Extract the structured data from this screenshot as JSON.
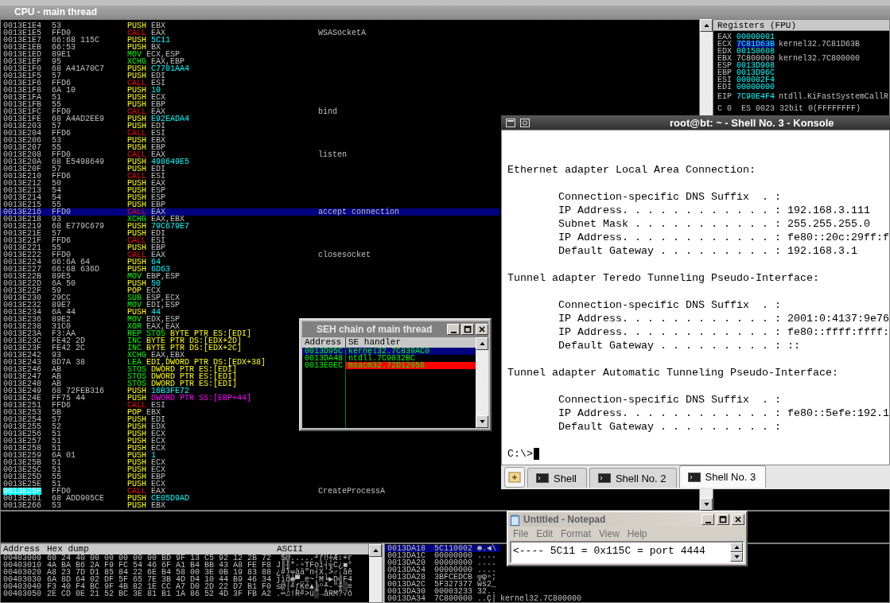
{
  "cpu_window": {
    "title": "CPU - main thread"
  },
  "disassembly": {
    "rows": [
      {
        "address": "0013E1E4",
        "hex": "53",
        "mnemonic": "PUSH",
        "kind": "stack",
        "operand": {
          "text": "EBX",
          "kind": "register"
        },
        "selected": false,
        "marked": false
      },
      {
        "address": "0013E1E5",
        "hex": "FFD0",
        "mnemonic": "CALL",
        "kind": "call",
        "operand": {
          "text": "EAX",
          "kind": "register"
        },
        "comment": "WSASocketA",
        "selected": false,
        "marked": false
      },
      {
        "address": "0013E1E7",
        "hex": "66:68 115C",
        "mnemonic": "PUSH",
        "kind": "stack",
        "operand": {
          "text": "5C11",
          "kind": "constant"
        },
        "selected": false,
        "marked": false
      },
      {
        "address": "0013E1EB",
        "hex": "66:53",
        "mnemonic": "PUSH",
        "kind": "stack",
        "operand": {
          "text": "BX",
          "kind": "register"
        },
        "selected": false,
        "marked": false
      },
      {
        "address": "0013E1ED",
        "hex": "89E1",
        "mnemonic": "MOV",
        "kind": "data",
        "operand": {
          "text": "ECX,ESP",
          "kind": "register"
        },
        "selected": false,
        "marked": false
      },
      {
        "address": "0013E1EF",
        "hex": "95",
        "mnemonic": "XCHG",
        "kind": "data",
        "operand": {
          "text": "EAX,EBP",
          "kind": "register"
        },
        "selected": false,
        "marked": false
      },
      {
        "address": "0013E1F0",
        "hex": "68 A41A70C7",
        "mnemonic": "PUSH",
        "kind": "stack",
        "operand": {
          "text": "C7701AA4",
          "kind": "constant"
        },
        "selected": false,
        "marked": false
      },
      {
        "address": "0013E1F5",
        "hex": "57",
        "mnemonic": "PUSH",
        "kind": "stack",
        "operand": {
          "text": "EDI",
          "kind": "register"
        },
        "selected": false,
        "marked": false
      },
      {
        "address": "0013E1F6",
        "hex": "FFD6",
        "mnemonic": "CALL",
        "kind": "call",
        "operand": {
          "text": "ESI",
          "kind": "register"
        },
        "selected": false,
        "marked": false
      },
      {
        "address": "0013E1F8",
        "hex": "6A 10",
        "mnemonic": "PUSH",
        "kind": "stack",
        "operand": {
          "text": "10",
          "kind": "constant"
        },
        "selected": false,
        "marked": false
      },
      {
        "address": "0013E1FA",
        "hex": "51",
        "mnemonic": "PUSH",
        "kind": "stack",
        "operand": {
          "text": "ECX",
          "kind": "register"
        },
        "selected": false,
        "marked": false
      },
      {
        "address": "0013E1FB",
        "hex": "55",
        "mnemonic": "PUSH",
        "kind": "stack",
        "operand": {
          "text": "EBP",
          "kind": "register"
        },
        "selected": false,
        "marked": false
      },
      {
        "address": "0013E1FC",
        "hex": "FFD0",
        "mnemonic": "CALL",
        "kind": "call",
        "operand": {
          "text": "EAX",
          "kind": "register"
        },
        "comment": "bind",
        "selected": false,
        "marked": false
      },
      {
        "address": "0013E1FE",
        "hex": "68 A4AD2EE9",
        "mnemonic": "PUSH",
        "kind": "stack",
        "operand": {
          "text": "E92EADA4",
          "kind": "constant"
        },
        "selected": false,
        "marked": false
      },
      {
        "address": "0013E203",
        "hex": "57",
        "mnemonic": "PUSH",
        "kind": "stack",
        "operand": {
          "text": "EDI",
          "kind": "register"
        },
        "selected": false,
        "marked": false
      },
      {
        "address": "0013E204",
        "hex": "FFD6",
        "mnemonic": "CALL",
        "kind": "call",
        "operand": {
          "text": "ESI",
          "kind": "register"
        },
        "selected": false,
        "marked": false
      },
      {
        "address": "0013E206",
        "hex": "53",
        "mnemonic": "PUSH",
        "kind": "stack",
        "operand": {
          "text": "EBX",
          "kind": "register"
        },
        "selected": false,
        "marked": false
      },
      {
        "address": "0013E207",
        "hex": "55",
        "mnemonic": "PUSH",
        "kind": "stack",
        "operand": {
          "text": "EBP",
          "kind": "register"
        },
        "selected": false,
        "marked": false
      },
      {
        "address": "0013E208",
        "hex": "FFD0",
        "mnemonic": "CALL",
        "kind": "call",
        "operand": {
          "text": "EAX",
          "kind": "register"
        },
        "comment": "listen",
        "selected": false,
        "marked": false
      },
      {
        "address": "0013E20A",
        "hex": "68 E5498649",
        "mnemonic": "PUSH",
        "kind": "stack",
        "operand": {
          "text": "498649E5",
          "kind": "constant"
        },
        "selected": false,
        "marked": false
      },
      {
        "address": "0013E20F",
        "hex": "57",
        "mnemonic": "PUSH",
        "kind": "stack",
        "operand": {
          "text": "EDI",
          "kind": "register"
        },
        "selected": false,
        "marked": false
      },
      {
        "address": "0013E210",
        "hex": "FFD6",
        "mnemonic": "CALL",
        "kind": "call",
        "operand": {
          "text": "ESI",
          "kind": "register"
        },
        "selected": false,
        "marked": false
      },
      {
        "address": "0013E212",
        "hex": "50",
        "mnemonic": "PUSH",
        "kind": "stack",
        "operand": {
          "text": "EAX",
          "kind": "register"
        },
        "selected": false,
        "marked": false
      },
      {
        "address": "0013E213",
        "hex": "54",
        "mnemonic": "PUSH",
        "kind": "stack",
        "operand": {
          "text": "ESP",
          "kind": "register"
        },
        "selected": false,
        "marked": false
      },
      {
        "address": "0013E214",
        "hex": "54",
        "mnemonic": "PUSH",
        "kind": "stack",
        "operand": {
          "text": "ESP",
          "kind": "register"
        },
        "selected": false,
        "marked": false
      },
      {
        "address": "0013E215",
        "hex": "55",
        "mnemonic": "PUSH",
        "kind": "stack",
        "operand": {
          "text": "EBP",
          "kind": "register"
        },
        "selected": false,
        "marked": false
      },
      {
        "address": "0013E216",
        "hex": "FFD0",
        "mnemonic": "CALL",
        "kind": "call",
        "operand": {
          "text": "EAX",
          "kind": "register"
        },
        "comment": "accept connection",
        "selected": true,
        "marked": false
      },
      {
        "address": "0013E218",
        "hex": "93",
        "mnemonic": "XCHG",
        "kind": "data",
        "operand": {
          "text": "EAX,EBX",
          "kind": "register"
        },
        "selected": false,
        "marked": false
      },
      {
        "address": "0013E219",
        "hex": "68 E779C679",
        "mnemonic": "PUSH",
        "kind": "stack",
        "operand": {
          "text": "79C679E7",
          "kind": "constant"
        },
        "selected": false,
        "marked": false
      },
      {
        "address": "0013E21E",
        "hex": "57",
        "mnemonic": "PUSH",
        "kind": "stack",
        "operand": {
          "text": "EDI",
          "kind": "register"
        },
        "selected": false,
        "marked": false
      },
      {
        "address": "0013E21F",
        "hex": "FFD6",
        "mnemonic": "CALL",
        "kind": "call",
        "operand": {
          "text": "ESI",
          "kind": "register"
        },
        "selected": false,
        "marked": false
      },
      {
        "address": "0013E221",
        "hex": "55",
        "mnemonic": "PUSH",
        "kind": "stack",
        "operand": {
          "text": "EBP",
          "kind": "register"
        },
        "selected": false,
        "marked": false
      },
      {
        "address": "0013E222",
        "hex": "FFD0",
        "mnemonic": "CALL",
        "kind": "call",
        "operand": {
          "text": "EAX",
          "kind": "register"
        },
        "comment": "closesocket",
        "selected": false,
        "marked": false
      },
      {
        "address": "0013E224",
        "hex": "66:6A 64",
        "mnemonic": "PUSH",
        "kind": "stack",
        "operand": {
          "text": "64",
          "kind": "constant"
        },
        "selected": false,
        "marked": false
      },
      {
        "address": "0013E227",
        "hex": "66:68 636D",
        "mnemonic": "PUSH",
        "kind": "stack",
        "operand": {
          "text": "6D63",
          "kind": "constant"
        },
        "selected": false,
        "marked": false
      },
      {
        "address": "0013E22B",
        "hex": "89E5",
        "mnemonic": "MOV",
        "kind": "data",
        "operand": {
          "text": "EBP,ESP",
          "kind": "register"
        },
        "selected": false,
        "marked": false
      },
      {
        "address": "0013E22D",
        "hex": "6A 50",
        "mnemonic": "PUSH",
        "kind": "stack",
        "operand": {
          "text": "50",
          "kind": "constant"
        },
        "selected": false,
        "marked": false
      },
      {
        "address": "0013E22F",
        "hex": "59",
        "mnemonic": "POP",
        "kind": "stack",
        "operand": {
          "text": "ECX",
          "kind": "register"
        },
        "selected": false,
        "marked": false
      },
      {
        "address": "0013E230",
        "hex": "29CC",
        "mnemonic": "SUB",
        "kind": "data",
        "operand": {
          "text": "ESP,ECX",
          "kind": "register"
        },
        "selected": false,
        "marked": false
      },
      {
        "address": "0013E232",
        "hex": "89E7",
        "mnemonic": "MOV",
        "kind": "data",
        "operand": {
          "text": "EDI,ESP",
          "kind": "register"
        },
        "selected": false,
        "marked": false
      },
      {
        "address": "0013E234",
        "hex": "6A 44",
        "mnemonic": "PUSH",
        "kind": "stack",
        "operand": {
          "text": "44",
          "kind": "constant"
        },
        "selected": false,
        "marked": false
      },
      {
        "address": "0013E236",
        "hex": "89E2",
        "mnemonic": "MOV",
        "kind": "data",
        "operand": {
          "text": "EDX,ESP",
          "kind": "register"
        },
        "selected": false,
        "marked": false
      },
      {
        "address": "0013E238",
        "hex": "31C0",
        "mnemonic": "XOR",
        "kind": "data",
        "operand": {
          "text": "EAX,EAX",
          "kind": "register"
        },
        "selected": false,
        "marked": false
      },
      {
        "address": "0013E23A",
        "hex": "F3:AA",
        "mnemonic": "REP STOS",
        "kind": "data",
        "operand": {
          "text": "BYTE PTR ES:[EDI]",
          "kind": "memory"
        },
        "selected": false,
        "marked": false
      },
      {
        "address": "0013E23C",
        "hex": "FE42 2D",
        "mnemonic": "INC",
        "kind": "data",
        "operand": {
          "text": "BYTE PTR DS:[EDX+2D]",
          "kind": "memory"
        },
        "selected": false,
        "marked": false
      },
      {
        "address": "0013E23F",
        "hex": "FE42 2C",
        "mnemonic": "INC",
        "kind": "data",
        "operand": {
          "text": "BYTE PTR DS:[EDX+2C]",
          "kind": "memory"
        },
        "selected": false,
        "marked": false
      },
      {
        "address": "0013E242",
        "hex": "93",
        "mnemonic": "XCHG",
        "kind": "data",
        "operand": {
          "text": "EAX,EBX",
          "kind": "register"
        },
        "selected": false,
        "marked": false
      },
      {
        "address": "0013E243",
        "hex": "8D7A 38",
        "mnemonic": "LEA",
        "kind": "data",
        "operand": {
          "text": "EDI,DWORD PTR DS:[EDX+38]",
          "kind": "memory"
        },
        "selected": false,
        "marked": false
      },
      {
        "address": "0013E246",
        "hex": "AB",
        "mnemonic": "STOS",
        "kind": "data",
        "operand": {
          "text": "DWORD PTR ES:[EDI]",
          "kind": "memory"
        },
        "selected": false,
        "marked": false
      },
      {
        "address": "0013E247",
        "hex": "AB",
        "mnemonic": "STOS",
        "kind": "data",
        "operand": {
          "text": "DWORD PTR ES:[EDI]",
          "kind": "memory"
        },
        "selected": false,
        "marked": false
      },
      {
        "address": "0013E248",
        "hex": "AB",
        "mnemonic": "STOS",
        "kind": "data",
        "operand": {
          "text": "DWORD PTR ES:[EDI]",
          "kind": "memory"
        },
        "selected": false,
        "marked": false
      },
      {
        "address": "0013E249",
        "hex": "68 72FEB316",
        "mnemonic": "PUSH",
        "kind": "stack",
        "operand": {
          "text": "16B3FE72",
          "kind": "constant"
        },
        "selected": false,
        "marked": false
      },
      {
        "address": "0013E24E",
        "hex": "FF75 44",
        "mnemonic": "PUSH",
        "kind": "stack",
        "operand": {
          "text": "DWORD PTR SS:[EBP+44]",
          "kind": "stack_memory"
        },
        "selected": false,
        "marked": false
      },
      {
        "address": "0013E251",
        "hex": "FFD6",
        "mnemonic": "CALL",
        "kind": "call",
        "operand": {
          "text": "ESI",
          "kind": "register"
        },
        "selected": false,
        "marked": false
      },
      {
        "address": "0013E253",
        "hex": "5B",
        "mnemonic": "POP",
        "kind": "stack",
        "operand": {
          "text": "EBX",
          "kind": "register"
        },
        "selected": false,
        "marked": false
      },
      {
        "address": "0013E254",
        "hex": "57",
        "mnemonic": "PUSH",
        "kind": "stack",
        "operand": {
          "text": "EDI",
          "kind": "register"
        },
        "selected": false,
        "marked": false
      },
      {
        "address": "0013E255",
        "hex": "52",
        "mnemonic": "PUSH",
        "kind": "stack",
        "operand": {
          "text": "EDX",
          "kind": "register"
        },
        "selected": false,
        "marked": false
      },
      {
        "address": "0013E256",
        "hex": "51",
        "mnemonic": "PUSH",
        "kind": "stack",
        "operand": {
          "text": "ECX",
          "kind": "register"
        },
        "selected": false,
        "marked": false
      },
      {
        "address": "0013E257",
        "hex": "51",
        "mnemonic": "PUSH",
        "kind": "stack",
        "operand": {
          "text": "ECX",
          "kind": "register"
        },
        "selected": false,
        "marked": false
      },
      {
        "address": "0013E258",
        "hex": "51",
        "mnemonic": "PUSH",
        "kind": "stack",
        "operand": {
          "text": "ECX",
          "kind": "register"
        },
        "selected": false,
        "marked": false
      },
      {
        "address": "0013E259",
        "hex": "6A 01",
        "mnemonic": "PUSH",
        "kind": "stack",
        "operand": {
          "text": "1",
          "kind": "constant"
        },
        "selected": false,
        "marked": false
      },
      {
        "address": "0013E25B",
        "hex": "51",
        "mnemonic": "PUSH",
        "kind": "stack",
        "operand": {
          "text": "ECX",
          "kind": "register"
        },
        "selected": false,
        "marked": false
      },
      {
        "address": "0013E25C",
        "hex": "51",
        "mnemonic": "PUSH",
        "kind": "stack",
        "operand": {
          "text": "ECX",
          "kind": "register"
        },
        "selected": false,
        "marked": false
      },
      {
        "address": "0013E25D",
        "hex": "55",
        "mnemonic": "PUSH",
        "kind": "stack",
        "operand": {
          "text": "EBP",
          "kind": "register"
        },
        "selected": false,
        "marked": false
      },
      {
        "address": "0013E25E",
        "hex": "51",
        "mnemonic": "PUSH",
        "kind": "stack",
        "operand": {
          "text": "ECX",
          "kind": "register"
        },
        "selected": false,
        "marked": false
      },
      {
        "address": "0013E25F",
        "hex": "FFD0",
        "mnemonic": "CALL",
        "kind": "call",
        "operand": {
          "text": "EAX",
          "kind": "register"
        },
        "comment": "CreateProcessA",
        "selected": false,
        "marked": true
      },
      {
        "address": "0013E261",
        "hex": "68 ADD905CE",
        "mnemonic": "PUSH",
        "kind": "stack",
        "operand": {
          "text": "CE05D9AD",
          "kind": "constant"
        },
        "selected": false,
        "marked": false
      },
      {
        "address": "0013E266",
        "hex": "53",
        "mnemonic": "PUSH",
        "kind": "stack",
        "operand": {
          "text": "EBX",
          "kind": "register"
        },
        "selected": false,
        "marked": false
      }
    ]
  },
  "registers": {
    "title": "Registers (FPU)",
    "rows": [
      {
        "name": "EAX",
        "value": "00000001",
        "changed": true,
        "selected": false
      },
      {
        "name": "ECX",
        "value": "7C81D63B",
        "comment": "kernel32.7C81D63B",
        "changed": true,
        "selected": true
      },
      {
        "name": "EDX",
        "value": "00150608",
        "changed": true,
        "selected": false
      },
      {
        "name": "EBX",
        "value": "7C800000",
        "comment": "kernel32.7C800000",
        "changed": false,
        "selected": false
      },
      {
        "name": "ESP",
        "value": "0013D908",
        "changed": true,
        "selected": false
      },
      {
        "name": "EBP",
        "value": "0013D96C",
        "changed": true,
        "selected": false
      },
      {
        "name": "ESI",
        "value": "000002F4",
        "changed": true,
        "selected": false
      },
      {
        "name": "EDI",
        "value": "00000000",
        "changed": true,
        "selected": false
      }
    ],
    "eip": {
      "name": "EIP",
      "value": "7C90E4F4",
      "comment": "ntdll.KiFastSystemCallR",
      "changed": true
    },
    "flags_line": "C 0  ES 0023 32bit 0(FFFFFFFF)"
  },
  "dump": {
    "columns": [
      "Address",
      "Hex dump",
      "ASCII"
    ],
    "rows": [
      {
        "address": "00403000",
        "bytes": "60 24 40 00 00 00 00 00 BD 9F 13 C5 92 12 2B 72",
        "ascii": "`$@.....╜ƒ‼┼Æ↕+r"
      },
      {
        "address": "00403010",
        "bytes": "4A BA B6 2A F9 FC 54 46 6F A1 B4 BB 43 A8 FE F8",
        "ascii": "J║╢*∙ⁿTFoí┤╗C¿■°"
      },
      {
        "address": "00403020",
        "bytes": "A8 23 7D D1 85 84 22 6E B4 58 00 3E 0B 19 83 88",
        "ascii": "¿#}╤àä\"n┤X.>♂↓âê"
      },
      {
        "address": "00403030",
        "bytes": "6A 8D 64 02 DF 5F 65 7E 3B 4D D4 10 44 B9 46 34",
        "ascii": "jìd☻▀_e~;M╘►D╣F4"
      },
      {
        "address": "00403040",
        "bytes": "F3 40 F4 BC 9F 4B 82 1E CC A7 D0 2D 22 D7 B1 F0",
        "ascii": "≤@⌠╝ƒKé▲╠º╨-\"╫▒≡"
      },
      {
        "address": "00403050",
        "bytes": "2E CD 0E 21 52 BC 3E 81 B1 1A 86 52 4D 3F FB A2",
        "ascii": ".═♫!R╝>ü▒→åRM?√ó"
      }
    ]
  },
  "stack": {
    "rows": [
      {
        "address": "0013DA18",
        "value": "5C110002",
        "ascii": "☻.◄\\",
        "selected": true
      },
      {
        "address": "0013DA1C",
        "value": "00000000",
        "ascii": "....",
        "selected": false
      },
      {
        "address": "0013DA20",
        "value": "00000000",
        "ascii": "....",
        "selected": false
      },
      {
        "address": "0013DA24",
        "value": "00000000",
        "ascii": "....",
        "selected": false
      },
      {
        "address": "0013DA28",
        "value": "3BFCEDCB",
        "ascii": "╦φⁿ;",
        "selected": false
      },
      {
        "address": "0013DA2C",
        "value": "5F327377",
        "ascii": "ws2_",
        "selected": false
      },
      {
        "address": "0013DA30",
        "value": "00003233",
        "ascii": "32..",
        "selected": false
      },
      {
        "address": "0013DA34",
        "value": "7C800000",
        "ascii": "..Ç|",
        "comment": "kernel32.7C800000",
        "selected": false
      }
    ]
  },
  "seh_window": {
    "title": "SEH chain of main thread",
    "columns": [
      "Address",
      "SE handler"
    ],
    "rows": [
      {
        "address": "0013D95C",
        "handler": "kernel32.7C839AC0",
        "selected": true,
        "flagged": false
      },
      {
        "address": "0013DA48",
        "handler": "ntdll.7C9032BC",
        "selected": false,
        "flagged": false
      },
      {
        "address": "0013E0EC",
        "handler": "msacm32.72D12956",
        "selected": false,
        "flagged": true
      }
    ]
  },
  "konsole": {
    "title": "root@bt: ~ - Shell No. 3 - Konsole",
    "blocks": [
      {
        "kind": "heading",
        "lines": [
          "Ethernet adapter Local Area Connection:"
        ]
      },
      {
        "kind": "entries",
        "lines": [
          "Connection-specific DNS Suffix  . :",
          "IP Address. . . . . . . . . . . . : 192.168.3.111",
          "Subnet Mask . . . . . . . . . . . : 255.255.255.0",
          "IP Address. . . . . . . . . . . . : fe80::20c:29ff:f",
          "Default Gateway . . . . . . . . . : 192.168.3.1"
        ]
      },
      {
        "kind": "heading",
        "lines": [
          "Tunnel adapter Teredo Tunneling Pseudo-Interface:"
        ]
      },
      {
        "kind": "entries",
        "lines": [
          "Connection-specific DNS Suffix  . :",
          "IP Address. . . . . . . . . . . . : 2001:0:4137:9e76",
          "IP Address. . . . . . . . . . . . : fe80::ffff:ffff:",
          "Default Gateway . . . . . . . . . : ::"
        ]
      },
      {
        "kind": "heading",
        "lines": [
          "Tunnel adapter Automatic Tunneling Pseudo-Interface:"
        ]
      },
      {
        "kind": "entries",
        "lines": [
          "Connection-specific DNS Suffix  . :",
          "IP Address. . . . . . . . . . . . : fe80::5efe:192.1",
          "Default Gateway . . . . . . . . . :"
        ]
      },
      {
        "kind": "prompt",
        "lines": [
          "C:\\>"
        ]
      }
    ],
    "tabs": [
      {
        "label": "Shell",
        "selected": false
      },
      {
        "label": "Shell No. 2",
        "selected": false
      },
      {
        "label": "Shell No. 3",
        "selected": true
      }
    ]
  },
  "notepad": {
    "title": "Untitled - Notepad",
    "menu": [
      "File",
      "Edit",
      "Format",
      "View",
      "Help"
    ],
    "text": "<---- 5C11 = 0x115C = port 4444"
  }
}
